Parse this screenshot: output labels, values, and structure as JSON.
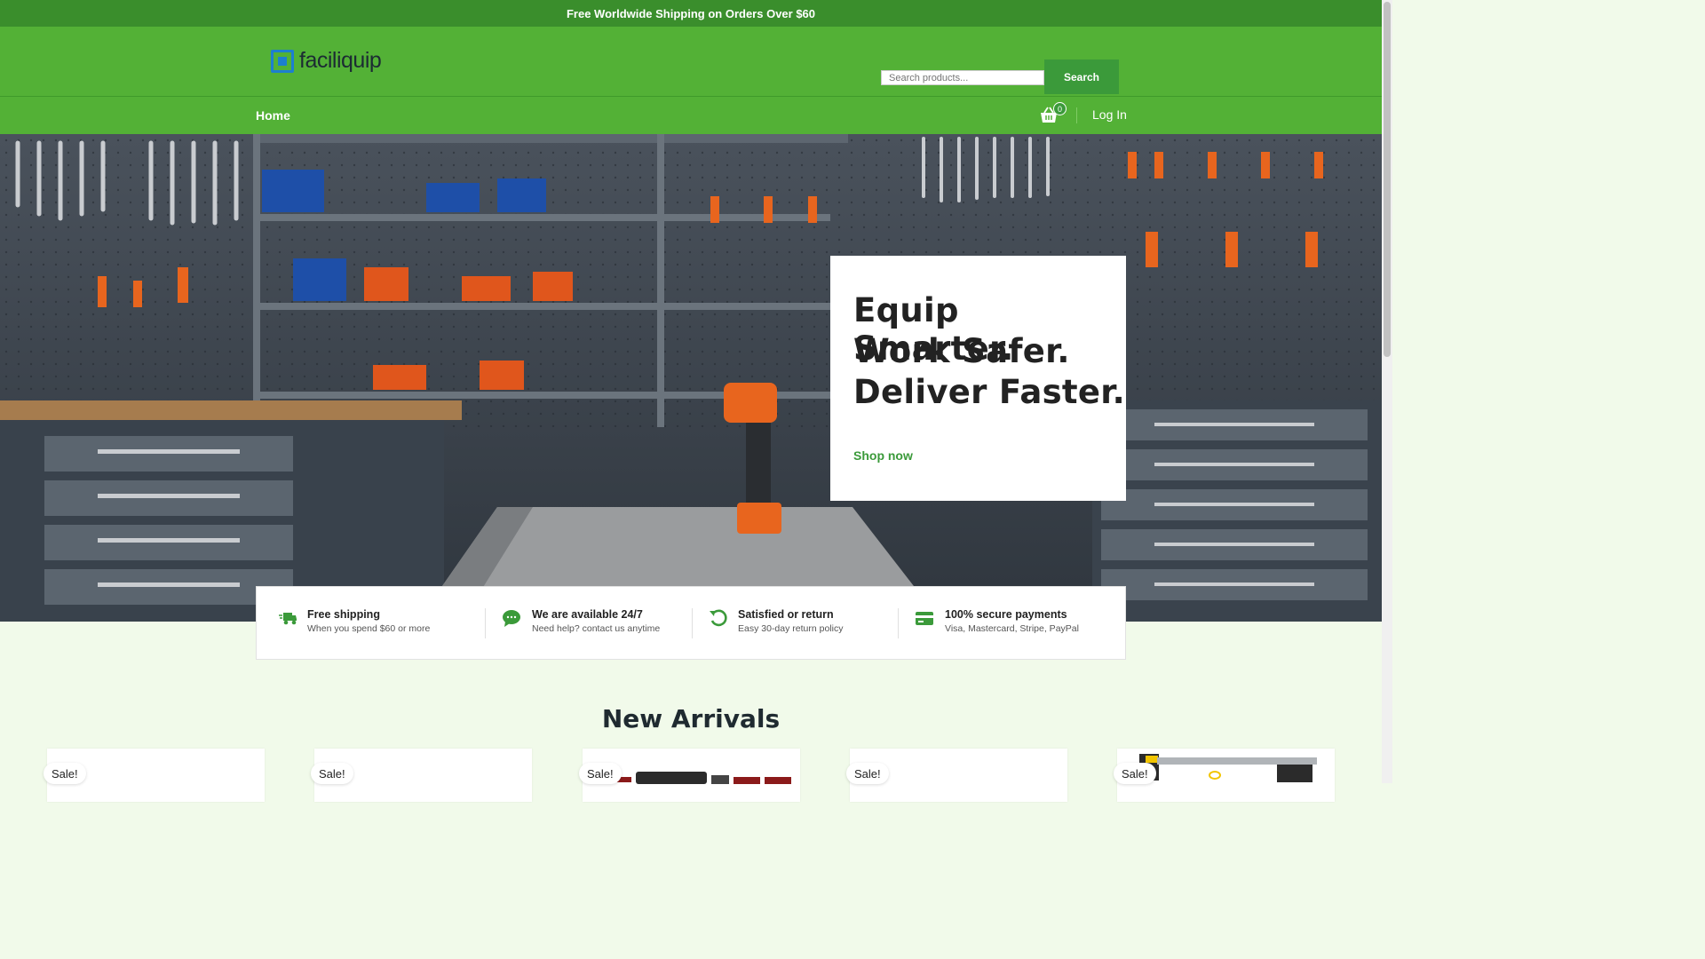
{
  "announcement": "Free Worldwide Shipping on Orders Over $60",
  "header": {
    "logo_text": "faciliquip",
    "search_placeholder": "Search products...",
    "search_button": "Search"
  },
  "nav": {
    "home": "Home",
    "cart_count": "0",
    "login": "Log In"
  },
  "hero": {
    "line1": "Equip Smarter.",
    "line2": "Work Safer.",
    "line3": "Deliver Faster.",
    "cta": "Shop now"
  },
  "features": [
    {
      "icon": "truck-icon",
      "title": "Free shipping",
      "subtitle": "When you spend $60 or more"
    },
    {
      "icon": "chat-icon",
      "title": "We are available 24/7",
      "subtitle": "Need help? contact us anytime"
    },
    {
      "icon": "return-icon",
      "title": "Satisfied or return",
      "subtitle": "Easy 30-day return policy"
    },
    {
      "icon": "credit-card-icon",
      "title": "100% secure payments",
      "subtitle": "Visa, Mastercard, Stripe, PayPal"
    }
  ],
  "section_title": "New Arrivals",
  "products": [
    {
      "badge": "Sale!"
    },
    {
      "badge": "Sale!"
    },
    {
      "badge": "Sale!"
    },
    {
      "badge": "Sale!"
    },
    {
      "badge": "Sale!"
    }
  ],
  "colors": {
    "brand_green": "#53b136",
    "dark_green": "#3a8e2c",
    "button_green": "#3b9a3a",
    "logo_blue": "#1d7fd0"
  }
}
